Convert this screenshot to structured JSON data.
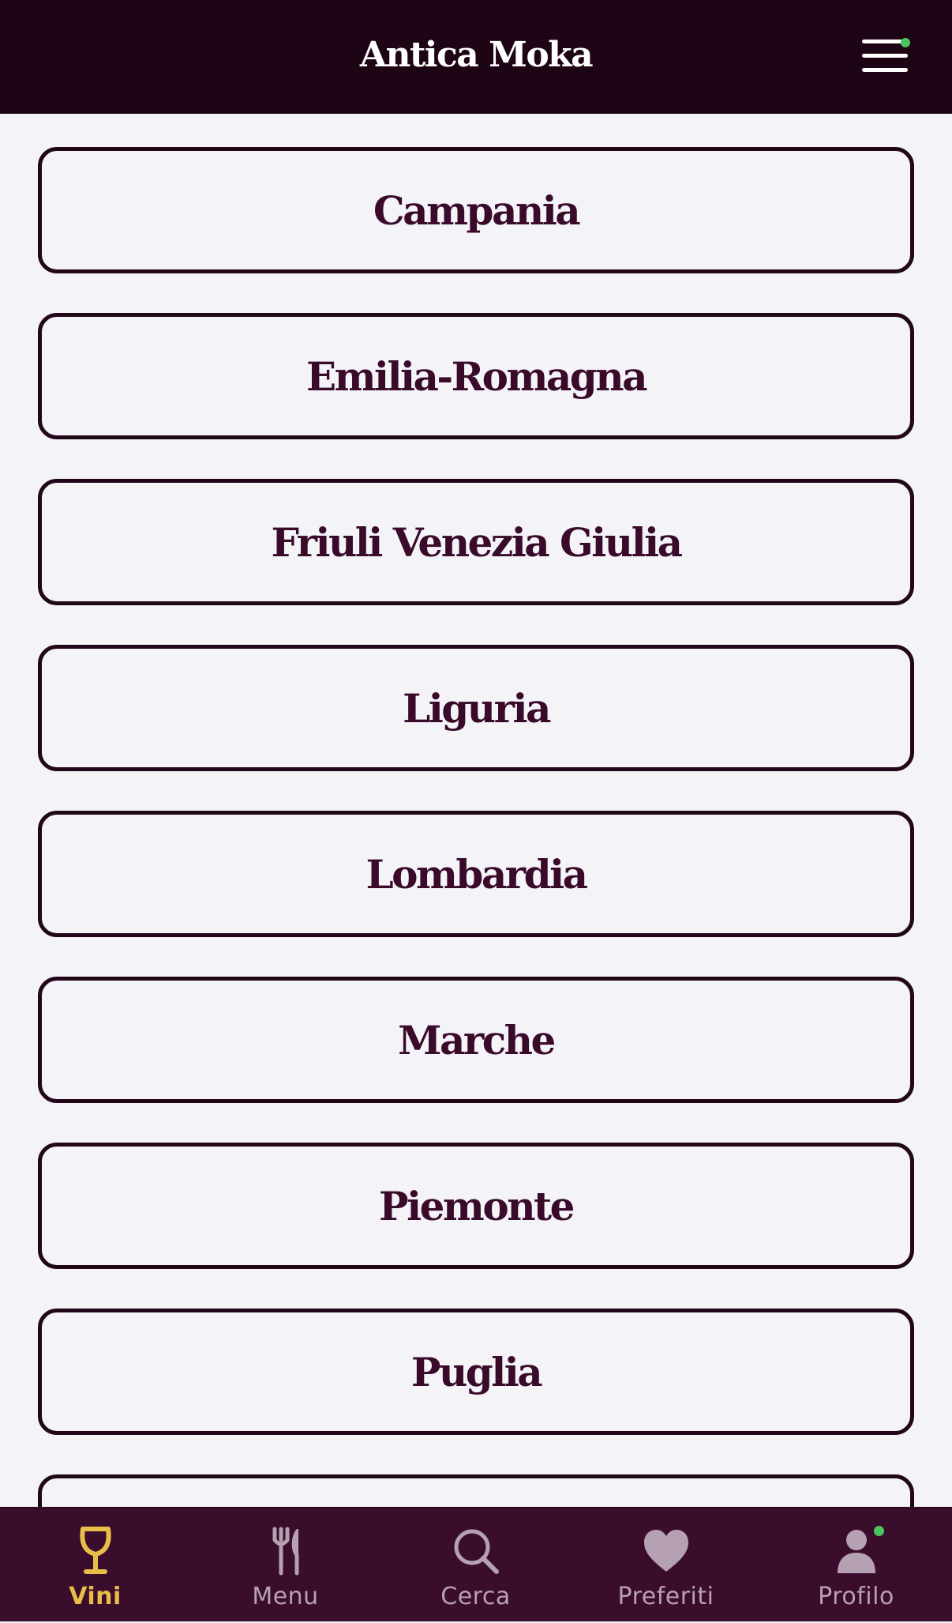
{
  "header": {
    "title": "Antica Moka",
    "menu_icon": "hamburger-menu-icon",
    "notification_color": "#4CC45F"
  },
  "regions": [
    {
      "label": "Campania"
    },
    {
      "label": "Emilia-Romagna"
    },
    {
      "label": "Friuli Venezia Giulia"
    },
    {
      "label": "Liguria"
    },
    {
      "label": "Lombardia"
    },
    {
      "label": "Marche"
    },
    {
      "label": "Piemonte"
    },
    {
      "label": "Puglia"
    },
    {
      "label": ""
    }
  ],
  "tabbar": {
    "tabs": [
      {
        "label": "Vini",
        "icon": "wine-glass-icon",
        "active": true
      },
      {
        "label": "Menu",
        "icon": "fork-knife-icon",
        "active": false
      },
      {
        "label": "Cerca",
        "icon": "search-icon",
        "active": false
      },
      {
        "label": "Preferiti",
        "icon": "heart-icon",
        "active": false
      },
      {
        "label": "Profilo",
        "icon": "user-icon",
        "active": false,
        "has_notification": true
      }
    ]
  },
  "colors": {
    "header_bg": "#1E0515",
    "page_bg": "#F3F3F8",
    "button_border": "#22071A",
    "button_text": "#3A0A2A",
    "tabbar_bg": "#3B0D2D",
    "tab_active": "#E8BE48",
    "tab_inactive": "#B5A1B2"
  }
}
